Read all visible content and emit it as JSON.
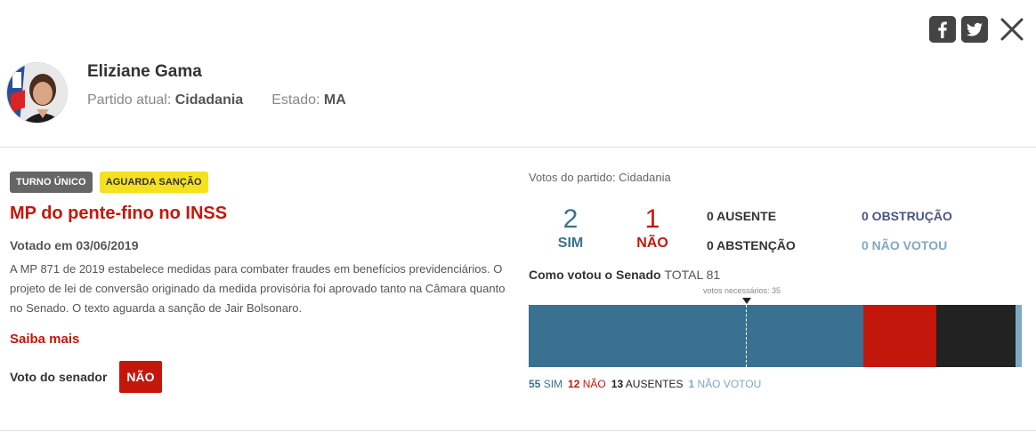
{
  "header": {
    "facebook_icon": "facebook-icon",
    "twitter_icon": "twitter-icon",
    "close_icon": "close-icon"
  },
  "profile": {
    "name": "Eliziane Gama",
    "party_label": "Partido atual:",
    "party": "Cidadania",
    "state_label": "Estado:",
    "state": "MA"
  },
  "vote": {
    "turn_badge": "TURNO ÚNICO",
    "status_badge": "AGUARDA SANÇÃO",
    "title": "MP do pente-fino no INSS",
    "date": "Votado em 03/06/2019",
    "description": "A MP 871 de 2019 estabelece medidas para combater fraudes em benefícios previdenciários. O projeto de lei de conversão originado da medida provisória foi aprovado tanto na Câmara quanto no Senado. O texto aguarda a sanção de Jair Bolsonaro.",
    "more_link": "Saiba mais",
    "senator_vote_label": "Voto do senador",
    "senator_vote": "NÃO"
  },
  "party_votes": {
    "label": "Votos do partido: Cidadania",
    "sim_count": "2",
    "sim_label": "SIM",
    "nao_count": "1",
    "nao_label": "NÃO",
    "ausente": "0 AUSENTE",
    "abstencao": "0 ABSTENÇÃO",
    "obstrucao": "0 OBSTRUÇÃO",
    "nao_votou": "0 NÃO VOTOU"
  },
  "senate": {
    "label": "Como votou o Senado",
    "total": "TOTAL 81",
    "needed_text": "votos necessários: 35",
    "needed_votes": 35,
    "total_votes": 81,
    "segments": [
      {
        "key": "sim",
        "value": 55,
        "color": "#3b7190"
      },
      {
        "key": "nao",
        "value": 12,
        "color": "#c4170c"
      },
      {
        "key": "ausentes",
        "value": 13,
        "color": "#222222"
      },
      {
        "key": "nao_votou",
        "value": 1,
        "color": "#7fa8c4"
      }
    ],
    "legend": {
      "sim_num": "55",
      "sim_lbl": "SIM",
      "nao_num": "12",
      "nao_lbl": "NÃO",
      "aus_num": "13",
      "aus_lbl": "AUSENTES",
      "nv_num": "1",
      "nv_lbl": "NÃO VOTOU"
    }
  },
  "colors": {
    "accent_red": "#c4170c",
    "sim_blue": "#3b7190",
    "obstrucao": "#4a5580",
    "nao_votou": "#7fa8c4",
    "badge_yellow": "#f4e120"
  }
}
